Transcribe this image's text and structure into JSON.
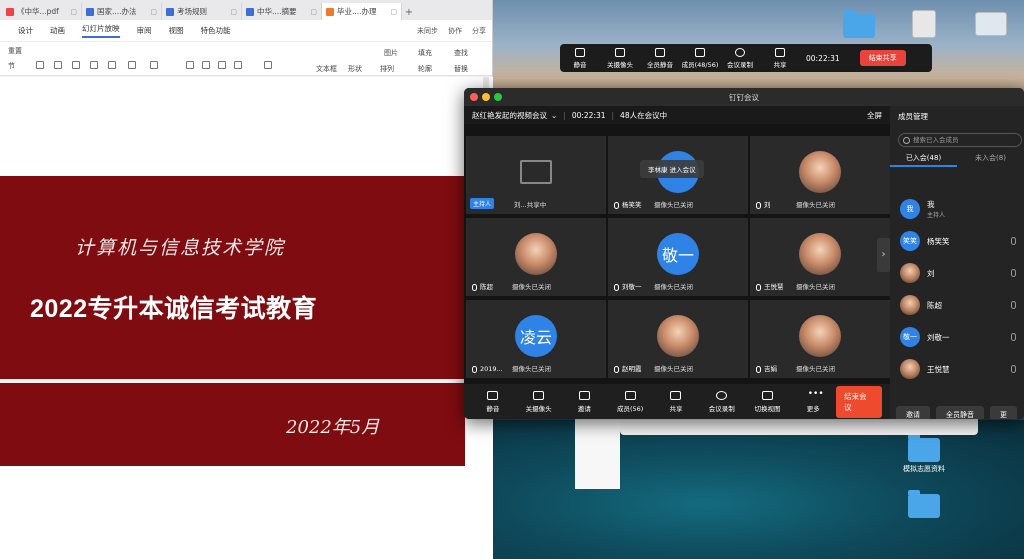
{
  "wps": {
    "tabs": [
      {
        "label": "《中华...pdf",
        "icon": "pdf-icon"
      },
      {
        "label": "国家....办法",
        "icon": "doc-icon"
      },
      {
        "label": "考场规则",
        "icon": "doc-icon"
      },
      {
        "label": "中华....摘要",
        "icon": "doc-icon"
      },
      {
        "label": "毕业....办理",
        "icon": "ppt-icon"
      }
    ],
    "ribbon_tabs": [
      "设计",
      "动画",
      "幻灯片放映",
      "审阅",
      "视图",
      "特色功能"
    ],
    "ribbon_right": [
      "未同步",
      "协作",
      "分享"
    ],
    "ribbon_labels": {
      "reset": "重置",
      "section": "节",
      "textbox": "文本框",
      "shape": "形状",
      "arrange": "排列",
      "picture": "图片",
      "fill": "填充",
      "outline": "轮廓",
      "find": "查找",
      "replace": "替换"
    },
    "slide": {
      "college": "计算机与信息技术学院",
      "title": "2022专升本诚信考试教育",
      "date": "2022年5月"
    }
  },
  "floatbar": {
    "items": [
      "静音",
      "关摄像头",
      "全员静音",
      "成员(48/56)",
      "会议录制",
      "共享"
    ],
    "time": "00:22:31",
    "end_label": "结束共享"
  },
  "meeting": {
    "window_title": "钉钉会议",
    "meeting_name": "赵红艳发起的视频会议",
    "elapsed": "00:22:31",
    "in_meeting": "48人在会议中",
    "fullscreen": "全屏",
    "join_popup": "李林康 进入会议",
    "tiles": [
      {
        "name": "主持人",
        "status": "刘...共享中",
        "avatar": "",
        "kind": "share"
      },
      {
        "name": "杨笑笑",
        "status": "摄像头已关闭",
        "avatar": "",
        "kind": "blue"
      },
      {
        "name": "刘",
        "status": "摄像头已关闭",
        "avatar": "",
        "kind": "img"
      },
      {
        "name": "陈超",
        "status": "摄像头已关闭",
        "avatar": "",
        "kind": "img"
      },
      {
        "name": "刘敬一",
        "status": "摄像头已关闭",
        "avatar": "敬一",
        "kind": "blue"
      },
      {
        "name": "王悦慧",
        "status": "摄像头已关闭",
        "avatar": "",
        "kind": "img"
      },
      {
        "name": "2019...",
        "status": "摄像头已关闭",
        "avatar": "凌云",
        "kind": "blue"
      },
      {
        "name": "赵明霞",
        "status": "摄像头已关闭",
        "avatar": "",
        "kind": "img"
      },
      {
        "name": "吉娟",
        "status": "摄像头已关闭",
        "avatar": "",
        "kind": "img"
      }
    ],
    "toolbar": [
      "静音",
      "关摄像头",
      "邀请",
      "成员(56)",
      "共享",
      "会议录制",
      "切换视图",
      "更多"
    ],
    "end_label": "结束会议",
    "members_panel": {
      "title": "成员管理",
      "search_placeholder": "搜索已入会成员",
      "tab_joined": "已入会(48)",
      "tab_not_joined": "未入会(8)",
      "members": [
        {
          "name": "我",
          "sub": "主持人",
          "avatar": "我"
        },
        {
          "name": "杨笑笑",
          "sub": "",
          "avatar": "笑笑"
        },
        {
          "name": "刘",
          "sub": "",
          "avatar": ""
        },
        {
          "name": "陈超",
          "sub": "",
          "avatar": ""
        },
        {
          "name": "刘敬一",
          "sub": "",
          "avatar": "敬一"
        },
        {
          "name": "王悦慧",
          "sub": "",
          "avatar": ""
        }
      ],
      "footer": [
        "邀请",
        "全员静音",
        "更"
      ]
    }
  },
  "desktop": {
    "icon_label": "模拟志愿资料"
  }
}
